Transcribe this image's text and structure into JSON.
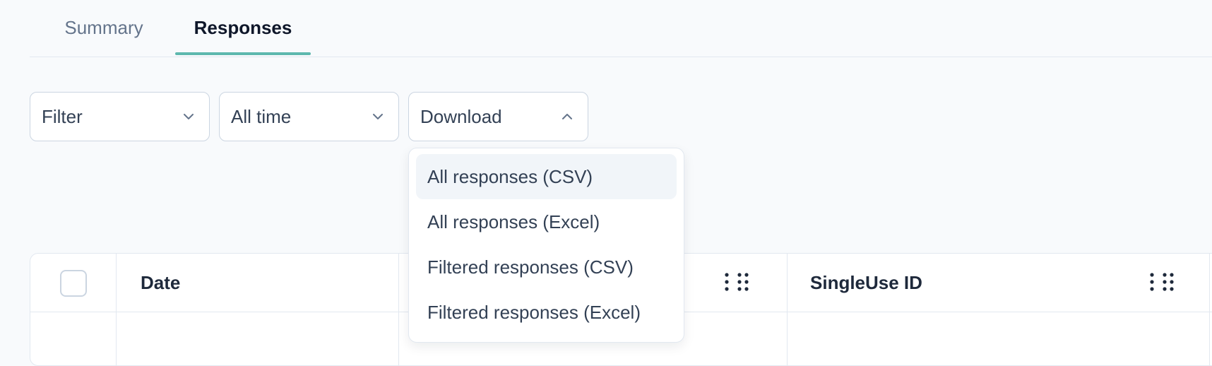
{
  "tabs": [
    {
      "label": "Summary",
      "active": false
    },
    {
      "label": "Responses",
      "active": true
    }
  ],
  "accent_color": "#5eb8ae",
  "toolbar": {
    "filter_label": "Filter",
    "time_label": "All time",
    "download_label": "Download"
  },
  "download_menu": {
    "open": true,
    "items": [
      {
        "label": "All responses (CSV)",
        "highlighted": true
      },
      {
        "label": "All responses (Excel)",
        "highlighted": false
      },
      {
        "label": "Filtered responses (CSV)",
        "highlighted": false
      },
      {
        "label": "Filtered responses (Excel)",
        "highlighted": false
      }
    ]
  },
  "table": {
    "columns": [
      {
        "label": "Date"
      },
      {
        "label": ""
      },
      {
        "label": "SingleUse ID"
      }
    ],
    "icons": {
      "column_menu": "vertical-dots-icon",
      "drag_handle": "drag-handle-icon",
      "dropdown": "chevron-down-icon",
      "dropdown_open": "chevron-up-icon"
    }
  }
}
